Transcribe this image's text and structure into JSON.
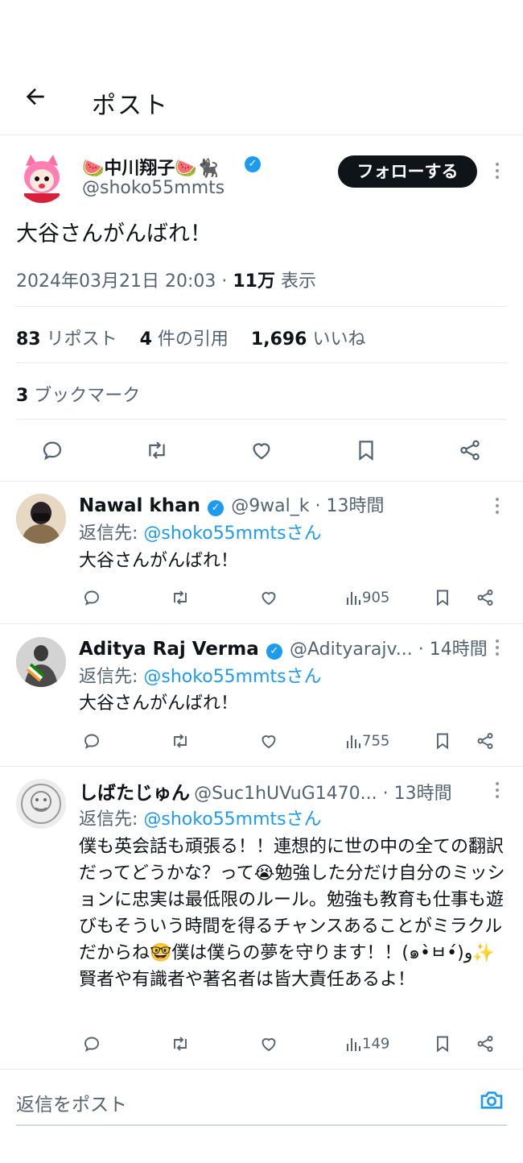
{
  "header": {
    "title": "ポスト"
  },
  "post": {
    "author_name": "🍉中川翔子🍉🐈‍⬛",
    "author_handle": "@shoko55mmts",
    "follow_label": "フォローする",
    "text": "大谷さんがんばれ！",
    "datetime": "2024年03月21日 20:03 · ",
    "views": "11万",
    "views_label": " 表示",
    "reposts": "83",
    "reposts_label": " リポスト",
    "quotes": "4",
    "quotes_label": " 件の引用",
    "likes": "1,696",
    "likes_label": " いいね",
    "bookmarks": "3",
    "bookmarks_label": " ブックマーク"
  },
  "replies": [
    {
      "name": "Nawal khan",
      "meta": "@9wal_k · 13時間",
      "reply_to_prefix": "返信先: ",
      "reply_to": "@shoko55mmtsさん",
      "text": "大谷さんがんばれ！",
      "views": "905"
    },
    {
      "name": "Aditya Raj Verma",
      "meta": "@Adityarajv... · 14時間",
      "reply_to_prefix": "返信先: ",
      "reply_to": "@shoko55mmtsさん",
      "text": "大谷さんがんばれ！",
      "views": "755"
    },
    {
      "name": "しばたじゅん",
      "meta": "@Suc1hUVuG1470... · 13時間",
      "reply_to_prefix": "返信先: ",
      "reply_to": "@shoko55mmtsさん",
      "text": "僕も英会話も頑張る！！連想的に世の中の全ての翻訳だってどうかな？って😭勉強した分だけ自分のミッションに忠実は最低限のルール。勉強も教育も仕事も遊びもそういう時間を得るチャンスあることがミラクルだからね🤓僕は僕らの夢を守ります！！(๑•̀ㅂ•́)و✨賢者や有識者や著名者は皆大責任あるよ！",
      "views": "149"
    }
  ],
  "composer": {
    "placeholder": "返信をポスト"
  },
  "colors": {
    "accent": "#1d9bf0",
    "text": "#0f1419",
    "muted": "#536471",
    "divider": "#e7e9ea"
  }
}
